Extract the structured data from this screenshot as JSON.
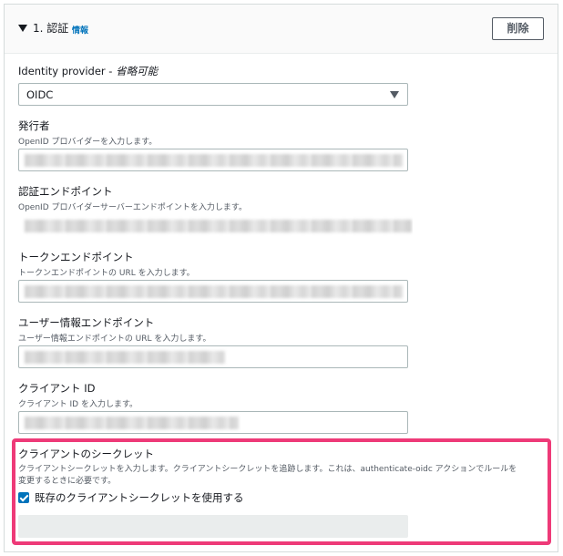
{
  "section": {
    "title": "1. 認証",
    "info_label": "情報",
    "delete_label": "削除"
  },
  "identity_provider": {
    "label": "Identity provider - ",
    "optional": "省略可能",
    "selected": "OIDC"
  },
  "fields": {
    "issuer": {
      "label": "発行者",
      "description": "OpenID プロバイダーを入力します。"
    },
    "auth_endpoint": {
      "label": "認証エンドポイント",
      "description": "OpenID プロバイダーサーバーエンドポイントを入力します。"
    },
    "token_endpoint": {
      "label": "トークンエンドポイント",
      "description": "トークンエンドポイントの URL を入力します。"
    },
    "userinfo_endpoint": {
      "label": "ユーザー情報エンドポイント",
      "description": "ユーザー情報エンドポイントの URL を入力します。"
    },
    "client_id": {
      "label": "クライアント ID",
      "description": "クライアント ID を入力します。"
    },
    "client_secret": {
      "label": "クライアントのシークレット",
      "description_line1": "クライアントシークレットを入力します。クライアントシークレットを追跡します。これは、authenticate-oidc アクションでルールを",
      "description_line2": "変更するときに必要です。",
      "checkbox_label": "既存のクライアントシークレットを使用する",
      "checkbox_checked": true
    }
  },
  "colors": {
    "highlight": "#ee3a78",
    "accent": "#0073bb"
  }
}
